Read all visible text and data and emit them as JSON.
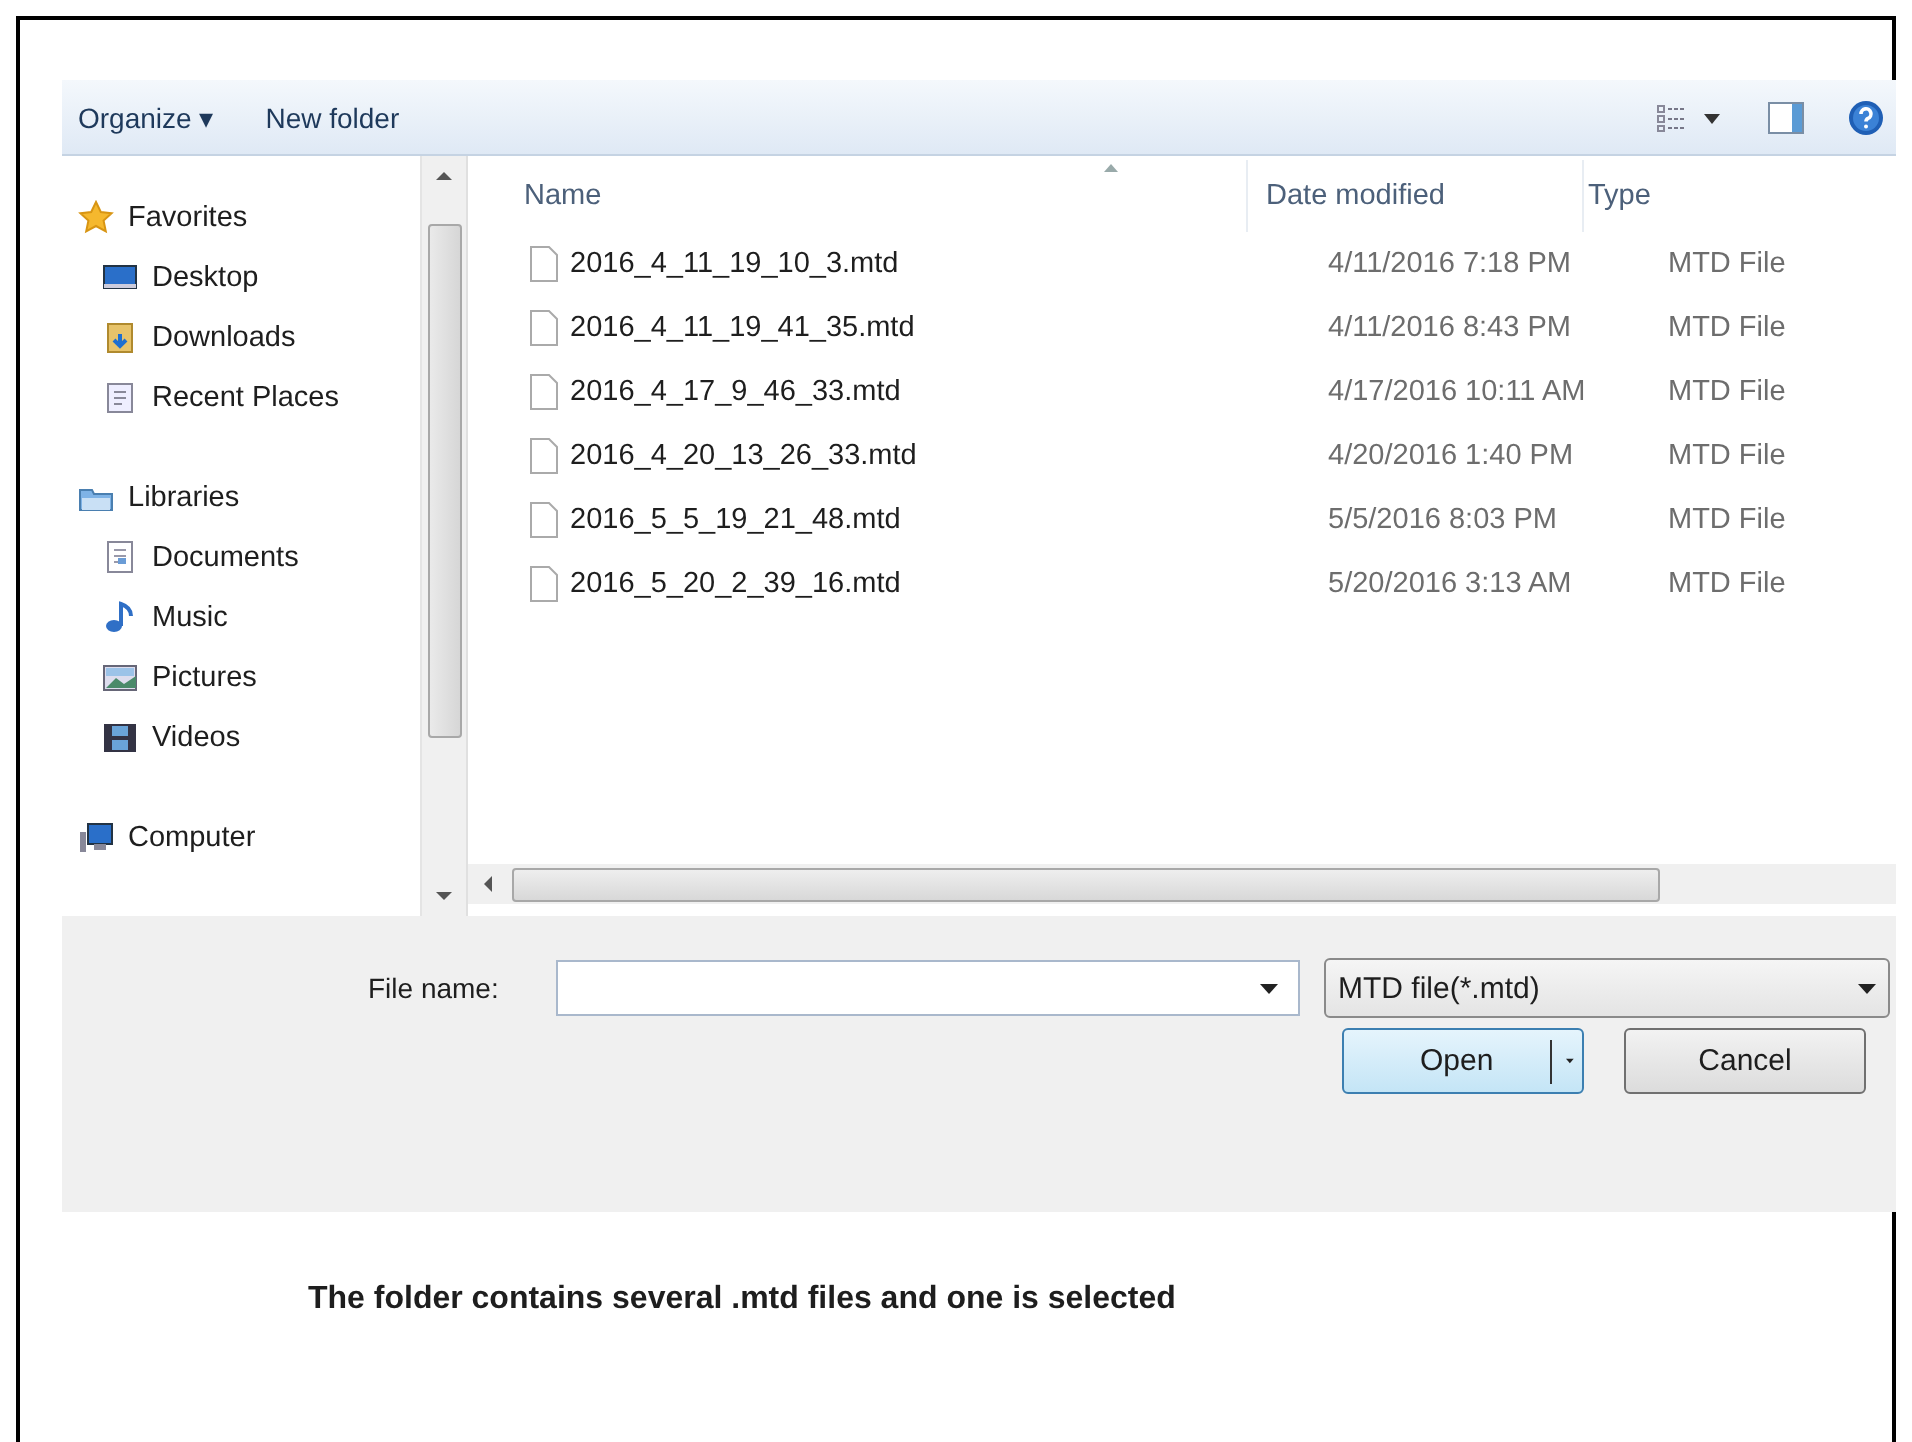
{
  "toolbar": {
    "organize": "Organize ▾",
    "new_folder": "New folder"
  },
  "nav": [
    {
      "label": "Favorites",
      "children": [
        {
          "label": "Desktop"
        },
        {
          "label": "Downloads"
        },
        {
          "label": "Recent Places"
        }
      ]
    },
    {
      "label": "Libraries",
      "children": [
        {
          "label": "Documents"
        },
        {
          "label": "Music"
        },
        {
          "label": "Pictures"
        },
        {
          "label": "Videos"
        }
      ]
    },
    {
      "label": "Computer"
    }
  ],
  "table": {
    "columns": [
      "Name",
      "Date modified",
      "Type"
    ],
    "rows": [
      {
        "name": "2016_4_11_19_10_3.mtd",
        "date": "4/11/2016 7:18 PM",
        "type": "MTD File",
        "selected": false
      },
      {
        "name": "2016_4_11_19_41_35.mtd",
        "date": "4/11/2016 8:43 PM",
        "type": "MTD File",
        "selected": false
      },
      {
        "name": "2016_4_17_9_46_33.mtd",
        "date": "4/17/2016 10:11 AM",
        "type": "MTD File",
        "selected": false
      },
      {
        "name": "2016_4_20_13_26_33.mtd",
        "date": "4/20/2016 1:40 PM",
        "type": "MTD File",
        "selected": false
      },
      {
        "name": "2016_5_5_19_21_48.mtd",
        "date": "5/5/2016 8:03 PM",
        "type": "MTD File",
        "selected": false
      },
      {
        "name": "2016_5_20_2_39_16.mtd",
        "date": "5/20/2016 3:13 AM",
        "type": "MTD File",
        "selected": false
      }
    ]
  },
  "file_name": {
    "label": "File name:"
  },
  "file_type": "MTD file(*.mtd)",
  "buttons": {
    "open": "Open",
    "cancel": "Cancel"
  },
  "caption": "The folder contains several .mtd files and one is selected"
}
